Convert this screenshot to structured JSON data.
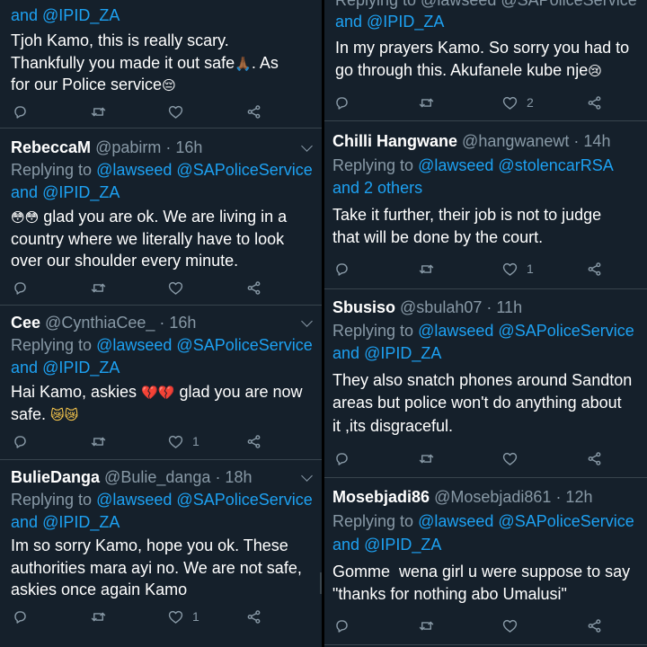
{
  "icons": {
    "reply": "reply-icon",
    "retweet": "retweet-icon",
    "like": "heart-icon",
    "share": "share-icon",
    "more": "chevron-down-icon"
  },
  "left": {
    "t1": {
      "replying_tail": "and @IPID_ZA",
      "body_1": "Tjoh Kamo, this is really scary.",
      "body_2a": "Thankfully you made it out safe",
      "body_2_emoji": "🙏🏾",
      "body_2b": ". As",
      "body_3a": "for our Police service",
      "body_3_emoji": "😔"
    },
    "t2": {
      "name": "RebeccaM",
      "handle": "@pabirm",
      "time": "· 16h",
      "replying_prefix": "Replying to",
      "mention_1": "@lawseed",
      "mention_2": "@SAPoliceService",
      "replying_and": "and",
      "mention_3": "@IPID_ZA",
      "body_1_emoji": "😳😳",
      "body_1": "glad you are ok. We are living in a",
      "body_2": "country where we literally have to look",
      "body_3": "over our shoulder every minute."
    },
    "t3": {
      "name": "Cee",
      "handle": "@CynthiaCee_",
      "time": "· 16h",
      "replying_prefix": "Replying to",
      "mention_1": "@lawseed",
      "mention_2": "@SAPoliceService",
      "replying_and": "and",
      "mention_3": "@IPID_ZA",
      "body_1a": "Hai Kamo, askies",
      "body_1_emoji": "💔💔",
      "body_1b": "glad you are now",
      "body_2a": "safe.",
      "body_2_emoji": "😿😿",
      "like_count": "1"
    },
    "t4": {
      "name": "BulieDanga",
      "handle": "@Bulie_danga",
      "time": "· 18h",
      "replying_prefix": "Replying to",
      "mention_1": "@lawseed",
      "mention_2": "@SAPoliceService",
      "replying_and": "and",
      "mention_3": "@IPID_ZA",
      "body_1": "Im so sorry Kamo, hope you ok. These",
      "body_2": "authorities mara ayi no. We are not safe,",
      "body_3": "askies once again Kamo",
      "like_count": "1"
    }
  },
  "right": {
    "t1": {
      "replying_top": "Replying to @lawseed @SAPoliceService",
      "replying_tail": "and @IPID_ZA",
      "body_1": "In my prayers Kamo. So sorry you had to",
      "body_2a": "go through this. Akufanele kube nje",
      "body_2_emoji": "😢",
      "like_count": "2"
    },
    "t2": {
      "name": "Chilli Hangwane",
      "handle": "@hangwanewt",
      "time": "· 14h",
      "replying_prefix": "Replying to",
      "mention_1": "@lawseed",
      "mention_2": "@stolencarRSA",
      "mention_3": "and 2 others",
      "body_1": "Take it further, their job is not to judge",
      "body_2": "that will be done by the court.",
      "like_count": "1"
    },
    "t3": {
      "name": "Sbusiso",
      "handle": "@sbulah07",
      "time": "· 11h",
      "replying_prefix": "Replying to",
      "mention_1": "@lawseed",
      "mention_2": "@SAPoliceService",
      "replying_and": "and",
      "mention_3": "@IPID_ZA",
      "body_1": "They also snatch phones around Sandton",
      "body_2": "areas but police won't do anything about",
      "body_3": "it ,its disgraceful."
    },
    "t4": {
      "name": "Mosebjadi86",
      "handle": "@Mosebjadi861",
      "time": "· 12h",
      "replying_prefix": "Replying to",
      "mention_1": "@lawseed",
      "mention_2": "@SAPoliceService",
      "replying_and": "and",
      "mention_3": "@IPID_ZA",
      "body_1": "Gomme  wena girl u were suppose to say",
      "body_2": "\"thanks for nothing abo Umalusi\""
    }
  }
}
